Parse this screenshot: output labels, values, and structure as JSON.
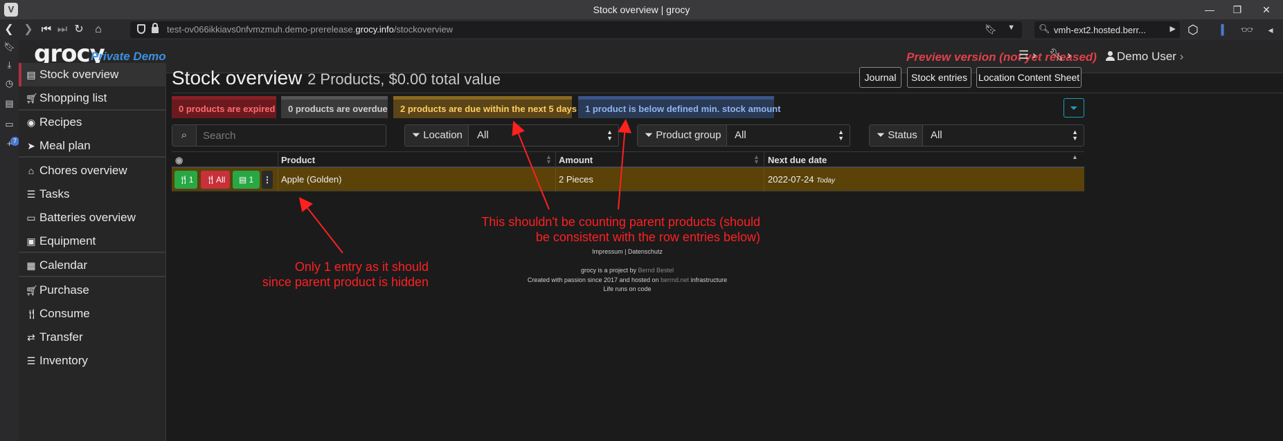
{
  "browser": {
    "window_title": "Stock overview | grocy",
    "url_prefix": "test-ov066ikkiavs0nfvmzmuh.demo-prerelease.",
    "url_domain": "grocy.info",
    "url_path": "/stockoverview",
    "search_text": "vmh-ext2.hosted.berr...",
    "panel_badge": "7"
  },
  "header": {
    "logo": "grocy",
    "subtitle": "Private Demo",
    "preview_notice": "Preview version (not yet released)",
    "user": "Demo User"
  },
  "sidebar": {
    "items": [
      {
        "label": "Stock overview",
        "icon": "box-icon"
      },
      {
        "label": "Shopping list",
        "icon": "cart-icon"
      },
      {
        "label": "Recipes",
        "icon": "rss-icon"
      },
      {
        "label": "Meal plan",
        "icon": "paper-plane-icon"
      },
      {
        "label": "Chores overview",
        "icon": "home-icon"
      },
      {
        "label": "Tasks",
        "icon": "tasks-icon"
      },
      {
        "label": "Batteries overview",
        "icon": "battery-icon"
      },
      {
        "label": "Equipment",
        "icon": "toolbox-icon"
      },
      {
        "label": "Calendar",
        "icon": "calendar-icon"
      },
      {
        "label": "Purchase",
        "icon": "cart-plus-icon"
      },
      {
        "label": "Consume",
        "icon": "utensils-icon"
      },
      {
        "label": "Transfer",
        "icon": "exchange-icon"
      },
      {
        "label": "Inventory",
        "icon": "list-icon"
      }
    ]
  },
  "page": {
    "title": "Stock overview",
    "summary": "2 Products, $0.00 total value",
    "buttons": {
      "journal": "Journal",
      "stock_entries": "Stock entries",
      "location_sheet": "Location Content Sheet"
    },
    "status": {
      "expired": "0 products are expired",
      "overdue": "0 products are overdue",
      "due_soon": "2 products are due within the next 5 days",
      "below_min": "1 product is below defined min. stock amount"
    },
    "search_placeholder": "Search",
    "filters": {
      "location_label": "Location",
      "location_value": "All",
      "group_label": "Product group",
      "group_value": "All",
      "status_label": "Status",
      "status_value": "All"
    }
  },
  "table": {
    "headers": {
      "product": "Product",
      "amount": "Amount",
      "next_due": "Next due date"
    },
    "rows": [
      {
        "consume_one": "1",
        "consume_all": "All",
        "open_one": "1",
        "more": "⋮",
        "product": "Apple (Golden)",
        "amount": "2 Pieces",
        "due_date": "2022-07-24",
        "due_relative": "Today"
      }
    ]
  },
  "annotations": {
    "note1_line1": "This shouldn't be counting parent products (should",
    "note1_line2": "be consistent with the row entries below)",
    "note2_line1": "Only 1 entry as it should",
    "note2_line2": "since parent product is hidden",
    "color": "#ff2020"
  },
  "footer": {
    "links": "Impressum | Datenschutz",
    "line1_a": "grocy is a project by ",
    "line1_link": "Bernd Bestel",
    "line2_a": "Created with passion since 2017 and hosted on ",
    "line2_link": "berrnd.net",
    "line2_b": " infrastructure",
    "line3": "Life runs on code"
  }
}
